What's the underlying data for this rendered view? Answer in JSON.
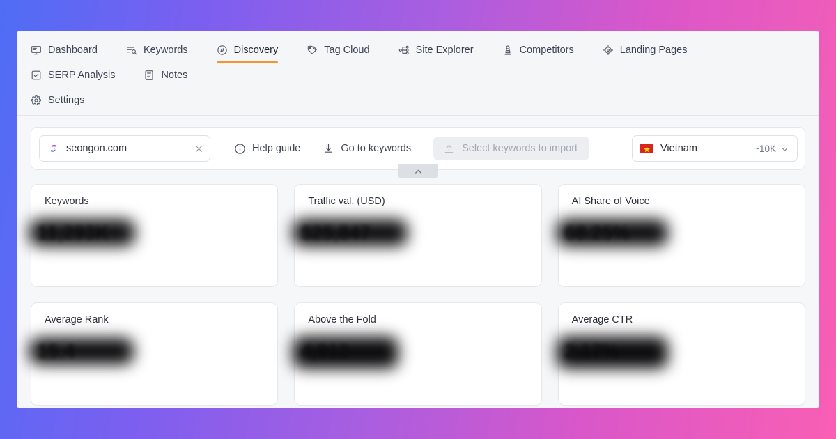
{
  "window": {
    "background_gradient_from": "#4f6df5",
    "background_gradient_to": "#f95fb4",
    "surface": "#f6f7f9"
  },
  "nav": {
    "active_tab": "Discovery",
    "accent_color": "#f59432",
    "items": [
      {
        "label": "Dashboard",
        "icon": "monitor-icon",
        "active": false
      },
      {
        "label": "Keywords",
        "icon": "list-search-icon",
        "active": false
      },
      {
        "label": "Discovery",
        "icon": "compass-icon",
        "active": true
      },
      {
        "label": "Tag Cloud",
        "icon": "tags-icon",
        "active": false
      },
      {
        "label": "Site Explorer",
        "icon": "sitemap-icon",
        "active": false
      },
      {
        "label": "Competitors",
        "icon": "pawn-icon",
        "active": false
      },
      {
        "label": "Landing Pages",
        "icon": "target-icon",
        "active": false
      },
      {
        "label": "SERP Analysis",
        "icon": "checkbox-icon",
        "active": false
      },
      {
        "label": "Notes",
        "icon": "document-icon",
        "active": false
      },
      {
        "label": "Settings",
        "icon": "gear-icon",
        "active": false
      }
    ]
  },
  "toolbar": {
    "domain_value": "seongon.com",
    "domain_placeholder": "Enter domain",
    "favicon": "seongon-logo-icon",
    "clear_icon": "close-icon",
    "help_guide_label": "Help guide",
    "help_guide_icon": "info-circle-icon",
    "go_to_keywords_label": "Go to keywords",
    "go_to_keywords_icon": "download-arrow-icon",
    "import_label": "Select keywords to import",
    "import_icon": "upload-icon",
    "import_disabled": true,
    "country_name": "Vietnam",
    "country_flag": "vietnam-flag-icon",
    "country_count": "~10K",
    "country_chevron": "chevron-down-icon",
    "collapse_icon": "chevron-up-icon"
  },
  "cards": [
    {
      "title": "Keywords",
      "value": "11,293K",
      "redacted": true
    },
    {
      "title": "Traffic val. (USD)",
      "value": "$25,847",
      "redacted": true
    },
    {
      "title": "AI Share of Voice",
      "value": "68.25%",
      "redacted": true
    },
    {
      "title": "Average Rank",
      "value": "15.4",
      "redacted": true
    },
    {
      "title": "Above the Fold",
      "value": "4,912",
      "redacted": true
    },
    {
      "title": "Average CTR",
      "value": "2.17%",
      "redacted": true
    }
  ]
}
